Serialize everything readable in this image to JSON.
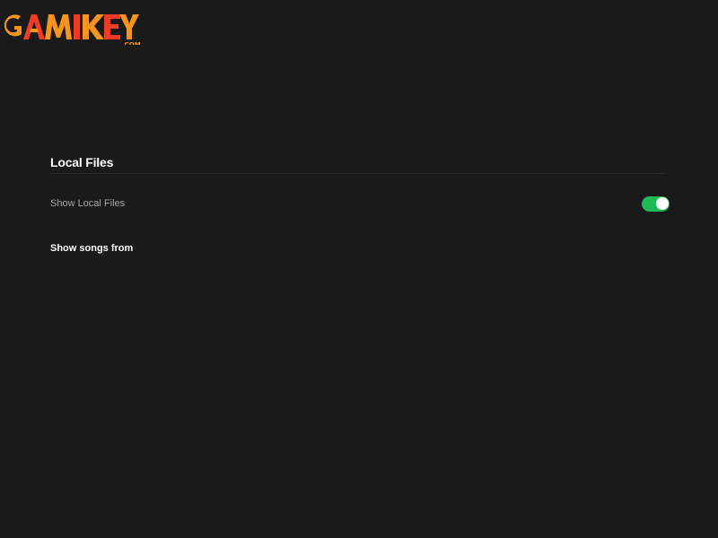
{
  "watermark": {
    "text": "GAMIKEY",
    "suffix": ".COM",
    "colors": {
      "orange": "#f7941d",
      "red": "#ef3b24"
    }
  },
  "local_files": {
    "title": "Local Files",
    "show_local_files": {
      "label": "Show Local Files",
      "enabled": true,
      "toggle_color": "#1db954"
    },
    "show_songs_from_label": "Show songs from"
  }
}
